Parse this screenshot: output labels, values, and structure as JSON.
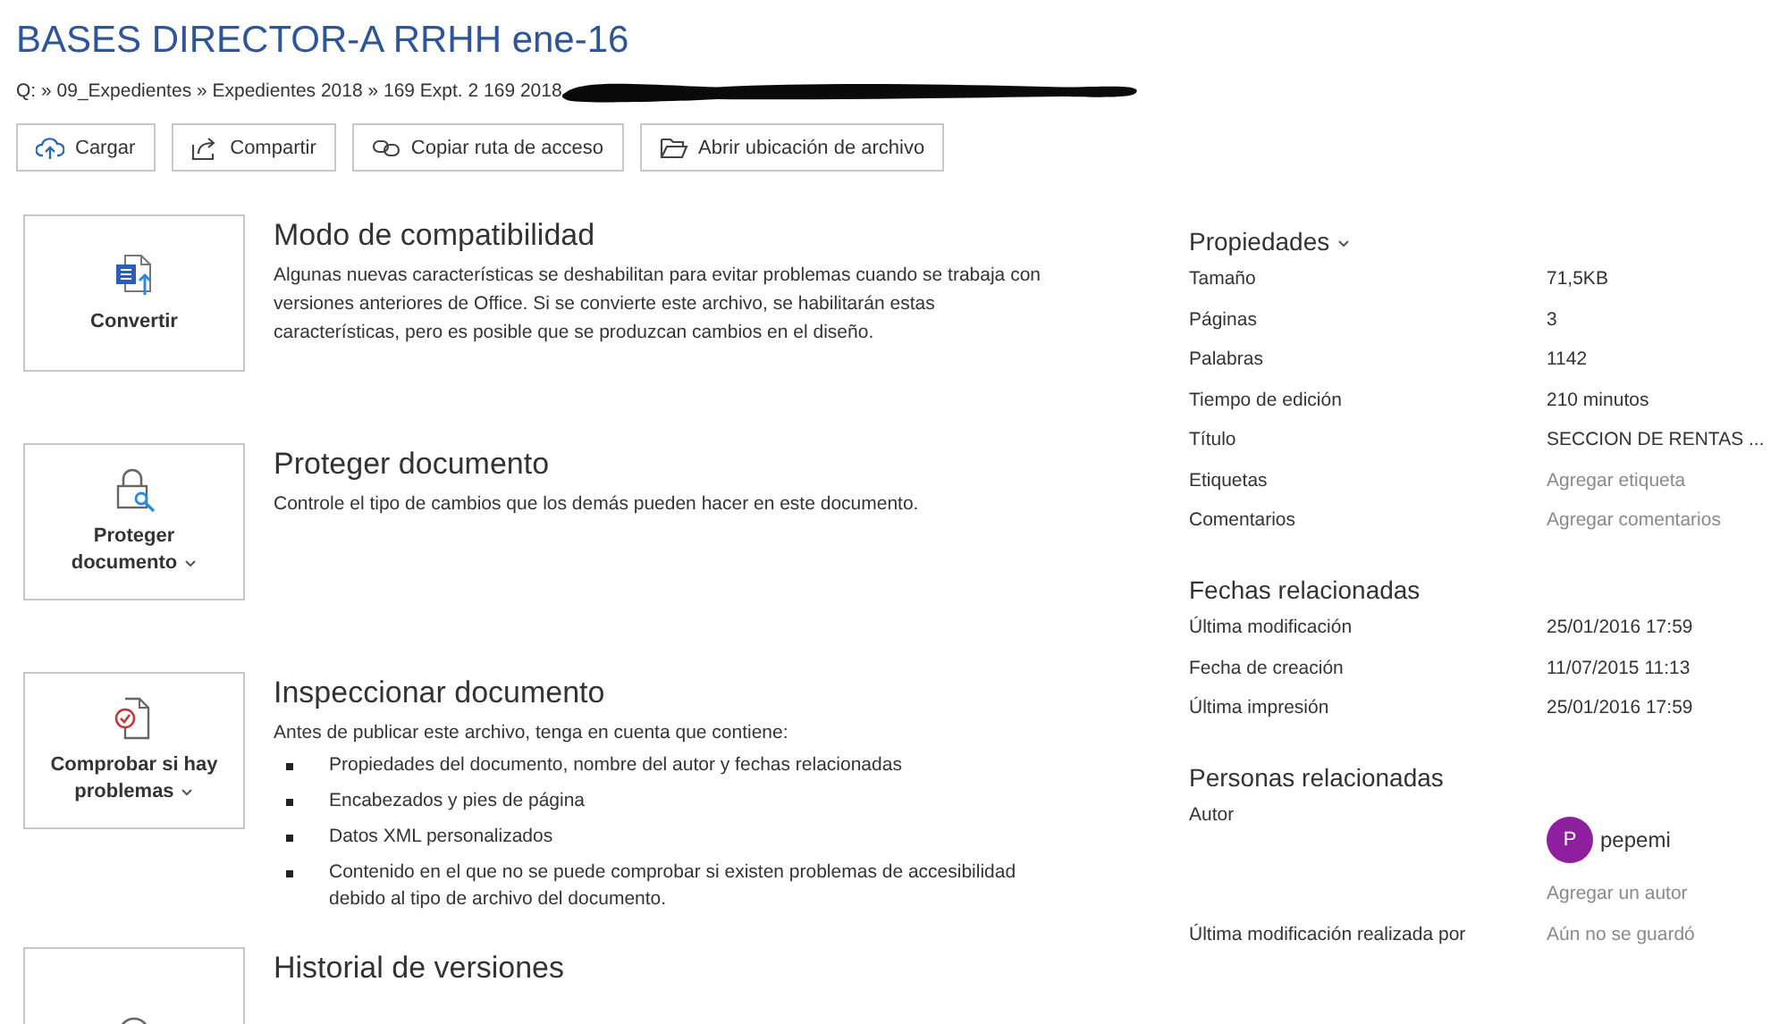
{
  "title": "BASES DIRECTOR-A RRHH ene-16",
  "path": "Q: » 09_Expedientes » Expedientes 2018 » 169 Expt. 2 169 2018",
  "redacted": true,
  "actions": [
    {
      "kind": "upload",
      "label": "Cargar"
    },
    {
      "kind": "share",
      "label": "Compartir"
    },
    {
      "kind": "link",
      "label": "Copiar ruta de acceso"
    },
    {
      "kind": "folder",
      "label": "Abrir ubicación de archivo"
    }
  ],
  "sections": [
    {
      "kind": "convert",
      "button": "Convertir",
      "dropdown": false,
      "heading": "Modo de compatibilidad",
      "text": "Algunas nuevas características se deshabilitan para evitar problemas cuando se trabaja con versiones anteriores de Office. Si se convierte este archivo, se habilitarán estas características, pero es posible que se produzcan cambios en el diseño."
    },
    {
      "kind": "protect",
      "button": "Proteger documento",
      "dropdown": true,
      "heading": "Proteger documento",
      "text": "Controle el tipo de cambios que los demás pueden hacer en este documento."
    },
    {
      "kind": "inspect",
      "button": "Comprobar si hay problemas",
      "dropdown": true,
      "heading": "Inspeccionar documento",
      "text": "Antes de publicar este archivo, tenga en cuenta que contiene:",
      "bullets": [
        "Propiedades del documento, nombre del autor y fechas relacionadas",
        "Encabezados y pies de página",
        "Datos XML personalizados",
        "Contenido en el que no se puede comprobar si existen problemas de accesibilidad debido al tipo de archivo del documento."
      ]
    },
    {
      "kind": "history",
      "heading": "Historial de versiones"
    }
  ],
  "properties": {
    "heading": "Propiedades",
    "dropdown": true,
    "rows": [
      {
        "label": "Tamaño",
        "value": "71,5KB"
      },
      {
        "label": "Páginas",
        "value": "3"
      },
      {
        "label": "Palabras",
        "value": "1142"
      },
      {
        "label": "Tiempo de edición",
        "value": "210 minutos"
      },
      {
        "label": "Título",
        "value": "SECCION DE RENTAS ..."
      },
      {
        "label": "Etiquetas",
        "placeholder": "Agregar etiqueta"
      },
      {
        "label": "Comentarios",
        "placeholder": "Agregar comentarios"
      }
    ]
  },
  "dates": {
    "heading": "Fechas relacionadas",
    "rows": [
      {
        "label": "Última modificación",
        "value": "25/01/2016 17:59"
      },
      {
        "label": "Fecha de creación",
        "value": "11/07/2015 11:13"
      },
      {
        "label": "Última impresión",
        "value": "25/01/2016 17:59"
      }
    ]
  },
  "people": {
    "heading": "Personas relacionadas",
    "author_label": "Autor",
    "author": {
      "initial": "P",
      "name": "pepemi",
      "color": "#8e1f9e"
    },
    "add_author": "Agregar un autor",
    "rows": [
      {
        "label": "Última modificación realizada por",
        "value": "Aún no se guardó",
        "muted": true
      }
    ]
  }
}
